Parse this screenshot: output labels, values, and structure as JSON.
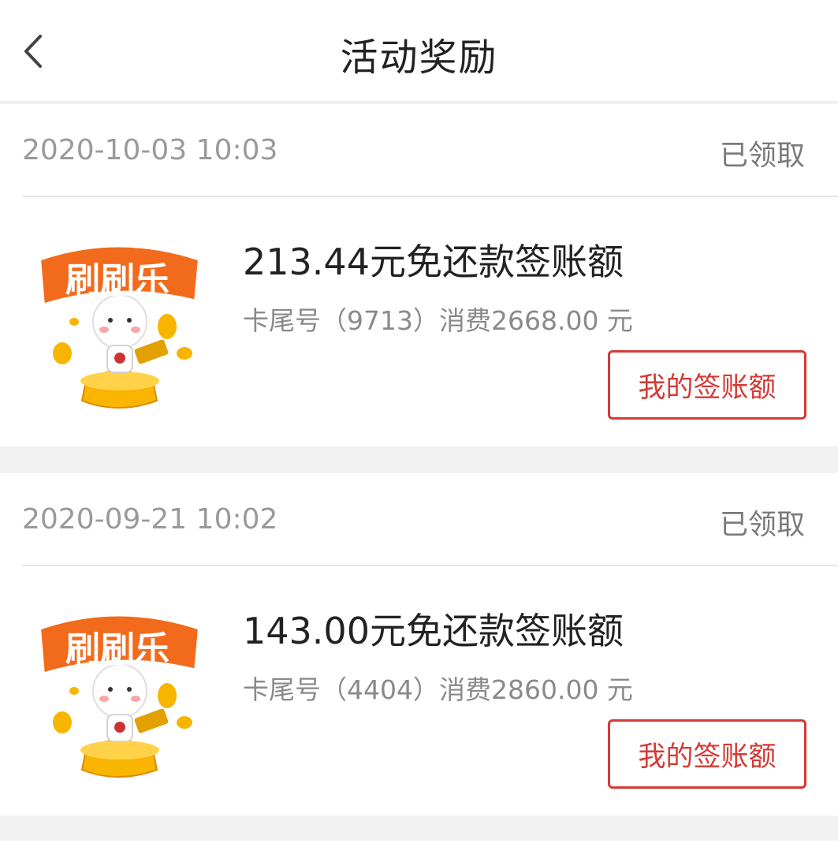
{
  "header": {
    "title": "活动奖励",
    "back_icon": "chevron-left-icon"
  },
  "rewards": [
    {
      "date": "2020-10-03 10:03",
      "status": "已领取",
      "image_icon": "shuashuale-mascot-icon",
      "image_text": "刷刷乐",
      "title": "213.44元免还款签账额",
      "detail": "卡尾号（9713）消费2668.00 元",
      "button": "我的签账额"
    },
    {
      "date": "2020-09-21 10:02",
      "status": "已领取",
      "image_icon": "shuashuale-mascot-icon",
      "image_text": "刷刷乐",
      "title": "143.00元免还款签账额",
      "detail": "卡尾号（4404）消费2860.00 元",
      "button": "我的签账额"
    }
  ],
  "colors": {
    "accent": "#d53a35",
    "background": "#f2f2f2",
    "logo_orange": "#f26a1b",
    "gold": "#f7b500"
  }
}
